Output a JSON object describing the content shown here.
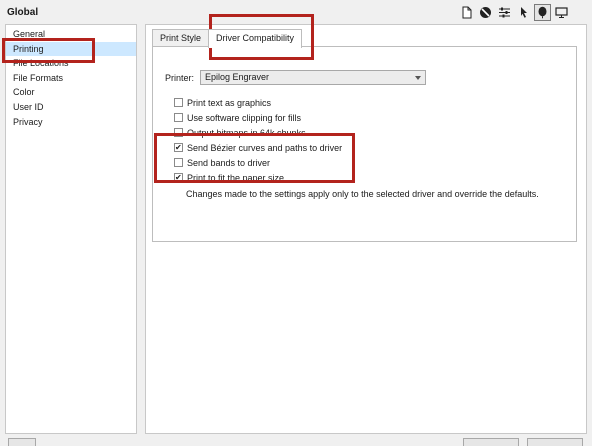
{
  "window": {
    "title": "Global"
  },
  "toolbar": {
    "icons": [
      "document-icon",
      "half-circle-icon",
      "sliders-icon",
      "pointer-icon",
      "balloon-icon",
      "monitor-icon"
    ],
    "active_index": 4
  },
  "sidebar": {
    "items": [
      {
        "label": "General"
      },
      {
        "label": "Printing"
      },
      {
        "label": "File Locations"
      },
      {
        "label": "File Formats"
      },
      {
        "label": "Color"
      },
      {
        "label": "User ID"
      },
      {
        "label": "Privacy"
      }
    ],
    "selected": "Printing"
  },
  "tabs": [
    {
      "label": "Print Style"
    },
    {
      "label": "Driver Compatibility"
    }
  ],
  "printer": {
    "label": "Printer:",
    "value": "Epilog Engraver"
  },
  "options": [
    {
      "label": "Print text as graphics",
      "checked": false
    },
    {
      "label": "Use software clipping for fills",
      "checked": false
    },
    {
      "label": "Output bitmaps in 64k chunks",
      "checked": false
    },
    {
      "label": "Send Bézier curves and paths to driver",
      "checked": true
    },
    {
      "label": "Send bands to driver",
      "checked": false
    },
    {
      "label": "Print to fit the paper size",
      "checked": true
    }
  ],
  "note": "Changes made to the settings apply only to the selected driver and override the defaults.",
  "colors": {
    "highlight": "#b3231d",
    "selection": "#cde8ff"
  }
}
